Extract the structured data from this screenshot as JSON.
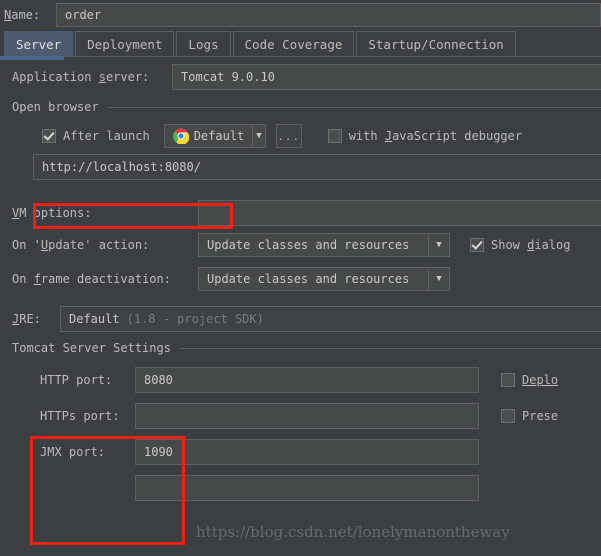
{
  "window": {
    "name_label": "Name:",
    "name_value": "order"
  },
  "tabs": [
    {
      "label": "Server",
      "active": true
    },
    {
      "label": "Deployment",
      "active": false
    },
    {
      "label": "Logs",
      "active": false
    },
    {
      "label": "Code Coverage",
      "active": false
    },
    {
      "label": "Startup/Connection",
      "active": false
    }
  ],
  "server": {
    "application_server_label": "Application server:",
    "application_server_value": "Tomcat 9.0.10",
    "open_browser_section": "Open browser",
    "after_launch_label": "After launch",
    "after_launch_checked": true,
    "browser_value": "Default",
    "browser_icon": "chrome-icon",
    "dropdown_arrow": "▼",
    "ellipsis_label": "...",
    "js_debugger_label": "with JavaScript debugger",
    "js_debugger_checked": false,
    "url_value": "http://localhost:8080/",
    "vm_options_label": "VM options:",
    "vm_options_value": "",
    "on_update_label": "On 'Update' action:",
    "on_update_value": "Update classes and resources",
    "show_dialog_label": "Show dialog",
    "show_dialog_checked": true,
    "on_frame_label": "On frame deactivation:",
    "on_frame_value": "Update classes and resources",
    "jre_label": "JRE:",
    "jre_value": "Default",
    "jre_hint": "(1.8 - project SDK)",
    "tomcat_settings_section": "Tomcat Server Settings",
    "http_port_label": "HTTP port:",
    "http_port_value": "8080",
    "https_port_label": "HTTPs port:",
    "https_port_value": "",
    "jmx_port_label": "JMX port:",
    "jmx_port_value": "1090",
    "deploy_label": "Deplo",
    "deploy_checked": false,
    "preserve_label": "Prese",
    "preserve_checked": false
  },
  "annotations": {
    "highlight_color": "#f22113",
    "watermark": "https://blog.csdn.net/lonelymanontheway"
  }
}
